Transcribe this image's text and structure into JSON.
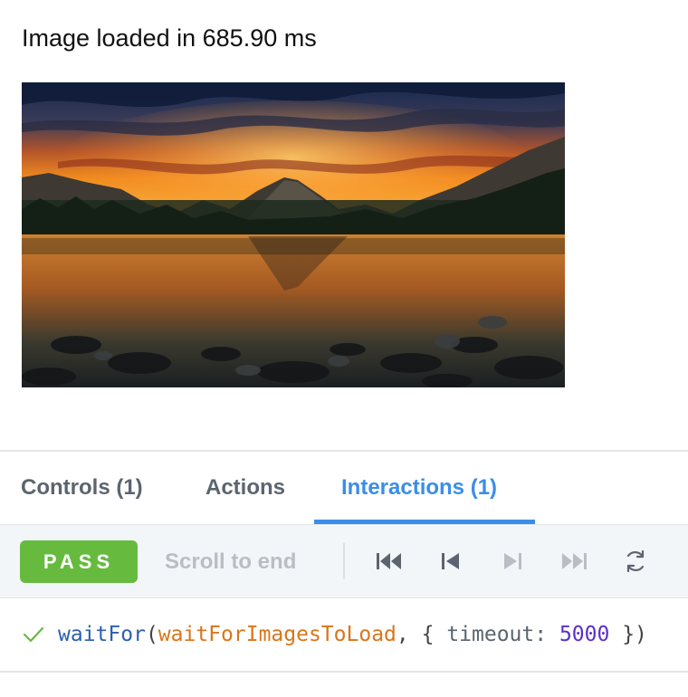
{
  "page": {
    "load_message": "Image loaded in 685.90 ms"
  },
  "image": {
    "description": "mountain-lake-sunset"
  },
  "tabs": [
    {
      "label": "Controls (1)",
      "active": false
    },
    {
      "label": "Actions",
      "active": false
    },
    {
      "label": "Interactions (1)",
      "active": true
    }
  ],
  "toolbar": {
    "status": "PASS",
    "status_color": "#66bb3f",
    "scroll_label": "Scroll to end",
    "controls": [
      "skip-to-start-icon",
      "step-back-icon",
      "step-forward-icon",
      "skip-to-end-icon",
      "rerun-icon"
    ]
  },
  "interaction": {
    "status_icon": "check-icon",
    "function": "waitFor",
    "paren_open": "(",
    "argument": "waitForImagesToLoad",
    "comma": ", ",
    "brace_open": "{ ",
    "option_key": "timeout",
    "colon": ": ",
    "option_value": "5000",
    "brace_close": " }",
    "paren_close": ")"
  },
  "colors": {
    "accent": "#3a8ee8",
    "pass": "#66bb3f",
    "tab_inactive": "#5c6470",
    "disabled": "#b9bec5"
  }
}
